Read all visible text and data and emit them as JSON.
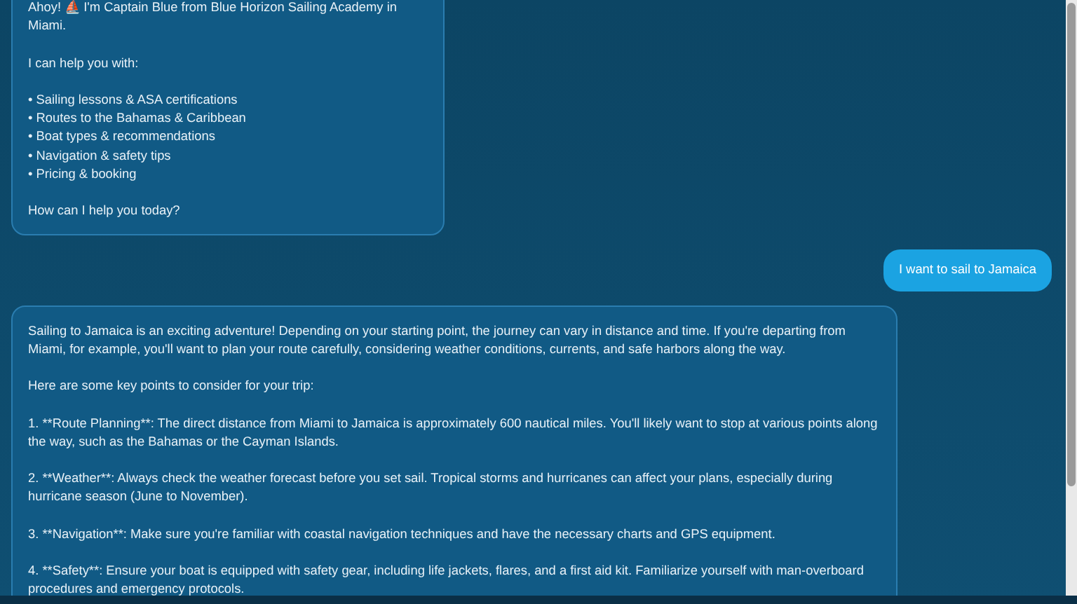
{
  "messages": [
    {
      "kind": "bot",
      "paragraphs": [
        "Ahoy! ⛵ I'm Captain Blue from Blue Horizon Sailing Academy in Miami.",
        "I can help you with:",
        "• Sailing lessons & ASA certifications\n• Routes to the Bahamas & Caribbean\n• Boat types & recommendations\n• Navigation & safety tips\n• Pricing & booking",
        "How can I help you today?"
      ]
    },
    {
      "kind": "user",
      "paragraphs": [
        "I want to sail to Jamaica"
      ]
    },
    {
      "kind": "bot",
      "paragraphs": [
        "Sailing to Jamaica is an exciting adventure! Depending on your starting point, the journey can vary in distance and time. If you're departing from Miami, for example, you'll want to plan your route carefully, considering weather conditions, currents, and safe harbors along the way.",
        "Here are some key points to consider for your trip:",
        "1. **Route Planning**: The direct distance from Miami to Jamaica is approximately 600 nautical miles. You'll likely want to stop at various points along the way, such as the Bahamas or the Cayman Islands.",
        "2. **Weather**: Always check the weather forecast before you set sail. Tropical storms and hurricanes can affect your plans, especially during hurricane season (June to November).",
        "3. **Navigation**: Make sure you're familiar with coastal navigation techniques and have the necessary charts and GPS equipment.",
        "4. **Safety**: Ensure your boat is equipped with safety gear, including life jackets, flares, and a first aid kit. Familiarize yourself with man-overboard procedures and emergency protocols."
      ]
    }
  ]
}
